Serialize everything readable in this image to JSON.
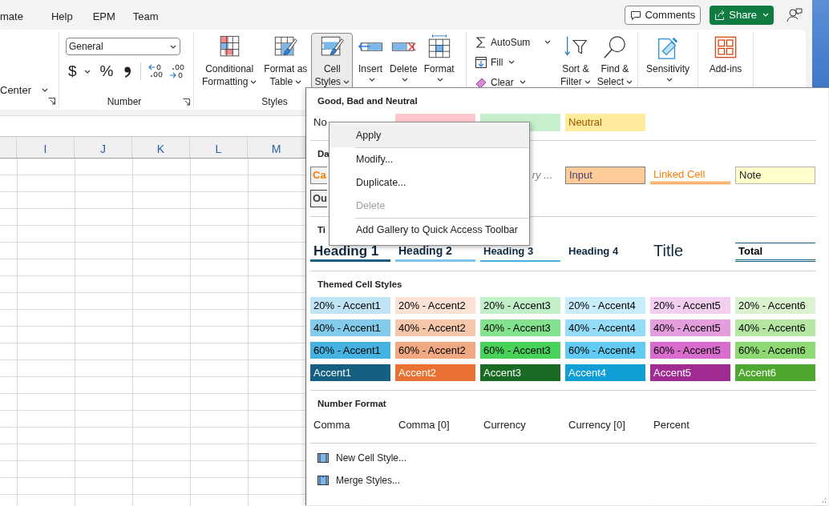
{
  "tabs": [
    {
      "label": "mate"
    },
    {
      "label": "Help"
    },
    {
      "label": "EPM"
    },
    {
      "label": "Team"
    }
  ],
  "header": {
    "comments": "Comments",
    "share": "Share"
  },
  "ribbon": {
    "alignment": {
      "merge": "Center"
    },
    "number": {
      "format": "General",
      "currency": "$",
      "percent": "%",
      "label": "Number"
    },
    "styles": {
      "label": "Styles",
      "buttons": [
        {
          "kind": "conditional",
          "label": "Conditional\nFormatting",
          "dropdown": true,
          "pressed": false
        },
        {
          "kind": "table",
          "label": "Format as\nTable",
          "dropdown": true,
          "pressed": false
        },
        {
          "kind": "cellstyles",
          "label": "Cell\nStyles",
          "dropdown": true,
          "pressed": true
        }
      ]
    },
    "cells": {
      "buttons": [
        {
          "kind": "insert",
          "label": "Insert",
          "dropdown": true
        },
        {
          "kind": "delete",
          "label": "Delete",
          "dropdown": true
        },
        {
          "kind": "format",
          "label": "Format",
          "dropdown": true
        }
      ]
    },
    "editing": {
      "small": [
        {
          "kind": "autosum",
          "label": "AutoSum",
          "dropdown": true
        },
        {
          "kind": "fill",
          "label": "Fill",
          "dropdown": true
        },
        {
          "kind": "clear",
          "label": "Clear",
          "dropdown": true
        }
      ],
      "buttons": [
        {
          "kind": "sort",
          "label": "Sort &\nFilter",
          "dropdown": true
        },
        {
          "kind": "find",
          "label": "Find &\nSelect",
          "dropdown": true
        }
      ]
    },
    "sensitivity": {
      "buttons": [
        {
          "kind": "sensitivity",
          "label": "Sensitivity",
          "dropdown": true
        }
      ]
    },
    "addins": {
      "buttons": [
        {
          "kind": "addins",
          "label": "Add-ins",
          "dropdown": false
        }
      ]
    }
  },
  "sheet": {
    "columns": [
      "I",
      "J",
      "K",
      "L",
      "M"
    ]
  },
  "gallery": {
    "sections": [
      {
        "title": "Good, Bad and Neutral",
        "rows": [
          [
            {
              "kind": "normal",
              "label": "No"
            },
            {
              "kind": "bad"
            },
            {
              "kind": "good"
            },
            {
              "kind": "neutral",
              "label": "Neutral"
            }
          ]
        ]
      },
      {
        "title": "Da",
        "rows": [
          [
            {
              "kind": "calculation",
              "label": "Ca"
            },
            {
              "kind": "explanatory",
              "label": "ry ..."
            },
            {
              "kind": "input",
              "label": "Input"
            },
            {
              "kind": "linked",
              "label": "Linked Cell"
            },
            {
              "kind": "note",
              "label": "Note"
            }
          ],
          [
            {
              "kind": "output",
              "label": "Ou"
            }
          ]
        ]
      },
      {
        "title": "Ti",
        "rows": [
          [
            {
              "kind": "heading1",
              "label": "Heading 1"
            },
            {
              "kind": "heading2",
              "label": "Heading 2"
            },
            {
              "kind": "heading3",
              "label": "Heading 3"
            },
            {
              "kind": "heading4",
              "label": "Heading 4"
            },
            {
              "kind": "title",
              "label": "Title"
            },
            {
              "kind": "total",
              "label": "Total"
            }
          ]
        ]
      },
      {
        "title": "Themed Cell Styles",
        "rows": [
          [
            {
              "kind": "tint",
              "label": "20% - Accent1",
              "color": "#c0e4f5"
            },
            {
              "kind": "tint",
              "label": "20% - Accent2",
              "color": "#fbe2d5"
            },
            {
              "kind": "tint",
              "label": "20% - Accent3",
              "color": "#c1f0c8"
            },
            {
              "kind": "tint",
              "label": "20% - Accent4",
              "color": "#caedfb"
            },
            {
              "kind": "tint",
              "label": "20% - Accent5",
              "color": "#f2ceef"
            },
            {
              "kind": "tint",
              "label": "20% - Accent6",
              "color": "#daf2d0"
            }
          ],
          [
            {
              "kind": "tint",
              "label": "40% - Accent1",
              "color": "#83cbeb"
            },
            {
              "kind": "tint",
              "label": "40% - Accent2",
              "color": "#f7c7ac"
            },
            {
              "kind": "tint",
              "label": "40% - Accent3",
              "color": "#83e28e"
            },
            {
              "kind": "tint",
              "label": "40% - Accent4",
              "color": "#94dcf8"
            },
            {
              "kind": "tint",
              "label": "40% - Accent5",
              "color": "#e59edd"
            },
            {
              "kind": "tint",
              "label": "40% - Accent6",
              "color": "#b5e6a2"
            }
          ],
          [
            {
              "kind": "tint",
              "label": "60% - Accent1",
              "color": "#44b3e1"
            },
            {
              "kind": "tint",
              "label": "60% - Accent2",
              "color": "#f1a983"
            },
            {
              "kind": "tint",
              "label": "60% - Accent3",
              "color": "#47d359"
            },
            {
              "kind": "tint",
              "label": "60% - Accent4",
              "color": "#61cbf3"
            },
            {
              "kind": "tint",
              "label": "60% - Accent5",
              "color": "#d86dcd"
            },
            {
              "kind": "tint",
              "label": "60% - Accent6",
              "color": "#8ed973"
            }
          ],
          [
            {
              "kind": "accent",
              "label": "Accent1",
              "color": "#156082"
            },
            {
              "kind": "accent",
              "label": "Accent2",
              "color": "#e97132"
            },
            {
              "kind": "accent",
              "label": "Accent3",
              "color": "#196b24"
            },
            {
              "kind": "accent",
              "label": "Accent4",
              "color": "#0f9ed5"
            },
            {
              "kind": "accent",
              "label": "Accent5",
              "color": "#a02b93"
            },
            {
              "kind": "accent",
              "label": "Accent6",
              "color": "#4ea72e"
            }
          ]
        ]
      },
      {
        "title": "Number Format",
        "rows": [
          [
            {
              "kind": "plain",
              "label": "Comma"
            },
            {
              "kind": "plain",
              "label": "Comma [0]"
            },
            {
              "kind": "plain",
              "label": "Currency"
            },
            {
              "kind": "plain",
              "label": "Currency [0]"
            },
            {
              "kind": "plain",
              "label": "Percent"
            }
          ]
        ]
      }
    ],
    "footer": [
      {
        "kind": "new",
        "label": "New Cell Style..."
      },
      {
        "kind": "merge",
        "label": "Merge Styles..."
      }
    ]
  },
  "context_menu": {
    "items": [
      {
        "kind": "item",
        "label": "Apply",
        "selected": true,
        "disabled": false
      },
      {
        "kind": "separator"
      },
      {
        "kind": "item",
        "label": "Modify...",
        "selected": false,
        "disabled": false
      },
      {
        "kind": "item",
        "label": "Duplicate...",
        "selected": false,
        "disabled": false
      },
      {
        "kind": "item",
        "label": "Delete",
        "selected": false,
        "disabled": true
      },
      {
        "kind": "separator"
      },
      {
        "kind": "item",
        "label": "Add Gallery to Quick Access Toolbar",
        "selected": false,
        "disabled": false
      }
    ]
  }
}
